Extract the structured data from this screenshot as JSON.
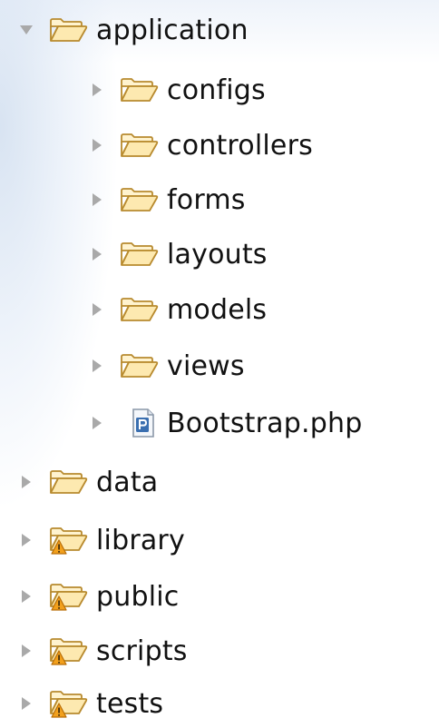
{
  "tree": {
    "items": [
      {
        "label": "application",
        "depth": 0,
        "expanded": true,
        "kind": "folder",
        "icon": "folder-open-icon"
      },
      {
        "label": "configs",
        "depth": 1,
        "expanded": false,
        "kind": "folder",
        "icon": "folder-open-icon"
      },
      {
        "label": "controllers",
        "depth": 1,
        "expanded": false,
        "kind": "folder",
        "icon": "folder-open-icon"
      },
      {
        "label": "forms",
        "depth": 1,
        "expanded": false,
        "kind": "folder",
        "icon": "folder-open-icon"
      },
      {
        "label": "layouts",
        "depth": 1,
        "expanded": false,
        "kind": "folder",
        "icon": "folder-open-icon"
      },
      {
        "label": "models",
        "depth": 1,
        "expanded": false,
        "kind": "folder",
        "icon": "folder-open-icon"
      },
      {
        "label": "views",
        "depth": 1,
        "expanded": false,
        "kind": "folder",
        "icon": "folder-open-icon"
      },
      {
        "label": "Bootstrap.php",
        "depth": 1,
        "expanded": false,
        "kind": "php-file",
        "icon": "php-file-icon"
      },
      {
        "label": "data",
        "depth": 0,
        "expanded": false,
        "kind": "folder",
        "icon": "folder-open-icon"
      },
      {
        "label": "library",
        "depth": 0,
        "expanded": false,
        "kind": "folder-warning",
        "icon": "folder-warning-icon"
      },
      {
        "label": "public",
        "depth": 0,
        "expanded": false,
        "kind": "folder-warning",
        "icon": "folder-warning-icon"
      },
      {
        "label": "scripts",
        "depth": 0,
        "expanded": false,
        "kind": "folder-warning",
        "icon": "folder-warning-icon"
      },
      {
        "label": "tests",
        "depth": 0,
        "expanded": false,
        "kind": "folder-warning",
        "icon": "folder-warning-icon"
      }
    ]
  },
  "colors": {
    "folder_fill": "#fde9b0",
    "folder_stroke": "#b88a2e",
    "warning": "#e08a12",
    "disclosure": "#a9a9a9",
    "php_badge": "#3a6fb0",
    "text": "#111111"
  }
}
